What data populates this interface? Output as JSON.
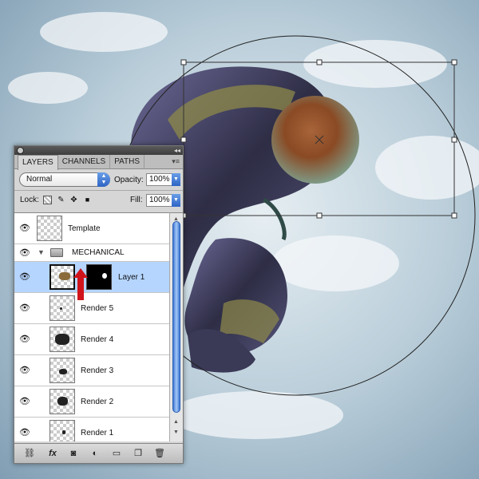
{
  "panel": {
    "tabs": [
      "LAYERS",
      "CHANNELS",
      "PATHS"
    ],
    "menu_icon": "panel-menu-icon",
    "blend_mode": "Normal",
    "opacity_label": "Opacity:",
    "opacity_value": "100%",
    "lock_label": "Lock:",
    "fill_label": "Fill:",
    "fill_value": "100%"
  },
  "layers": [
    {
      "name": "Template",
      "type": "layer",
      "visible": true
    },
    {
      "name": "MECHANICAL",
      "type": "group",
      "visible": true,
      "expanded": true
    },
    {
      "name": "Layer 1",
      "type": "layer",
      "visible": true,
      "selected": true,
      "has_mask": true
    },
    {
      "name": "Render 5",
      "type": "layer",
      "visible": true
    },
    {
      "name": "Render 4",
      "type": "layer",
      "visible": true
    },
    {
      "name": "Render 3",
      "type": "layer",
      "visible": true
    },
    {
      "name": "Render 2",
      "type": "layer",
      "visible": true
    },
    {
      "name": "Render 1",
      "type": "layer",
      "visible": true
    }
  ],
  "bottom_icons": [
    "link-icon",
    "fx-icon",
    "add-mask-icon",
    "adjustment-layer-icon",
    "new-group-icon",
    "new-layer-icon",
    "trash-icon"
  ],
  "bottom_labels": {
    "fx": "fx"
  },
  "colors": {
    "selected_row": "#b5d5ff",
    "scrollbar_blue": "#3f7ad6",
    "annotation_arrow": "#d0141c"
  }
}
